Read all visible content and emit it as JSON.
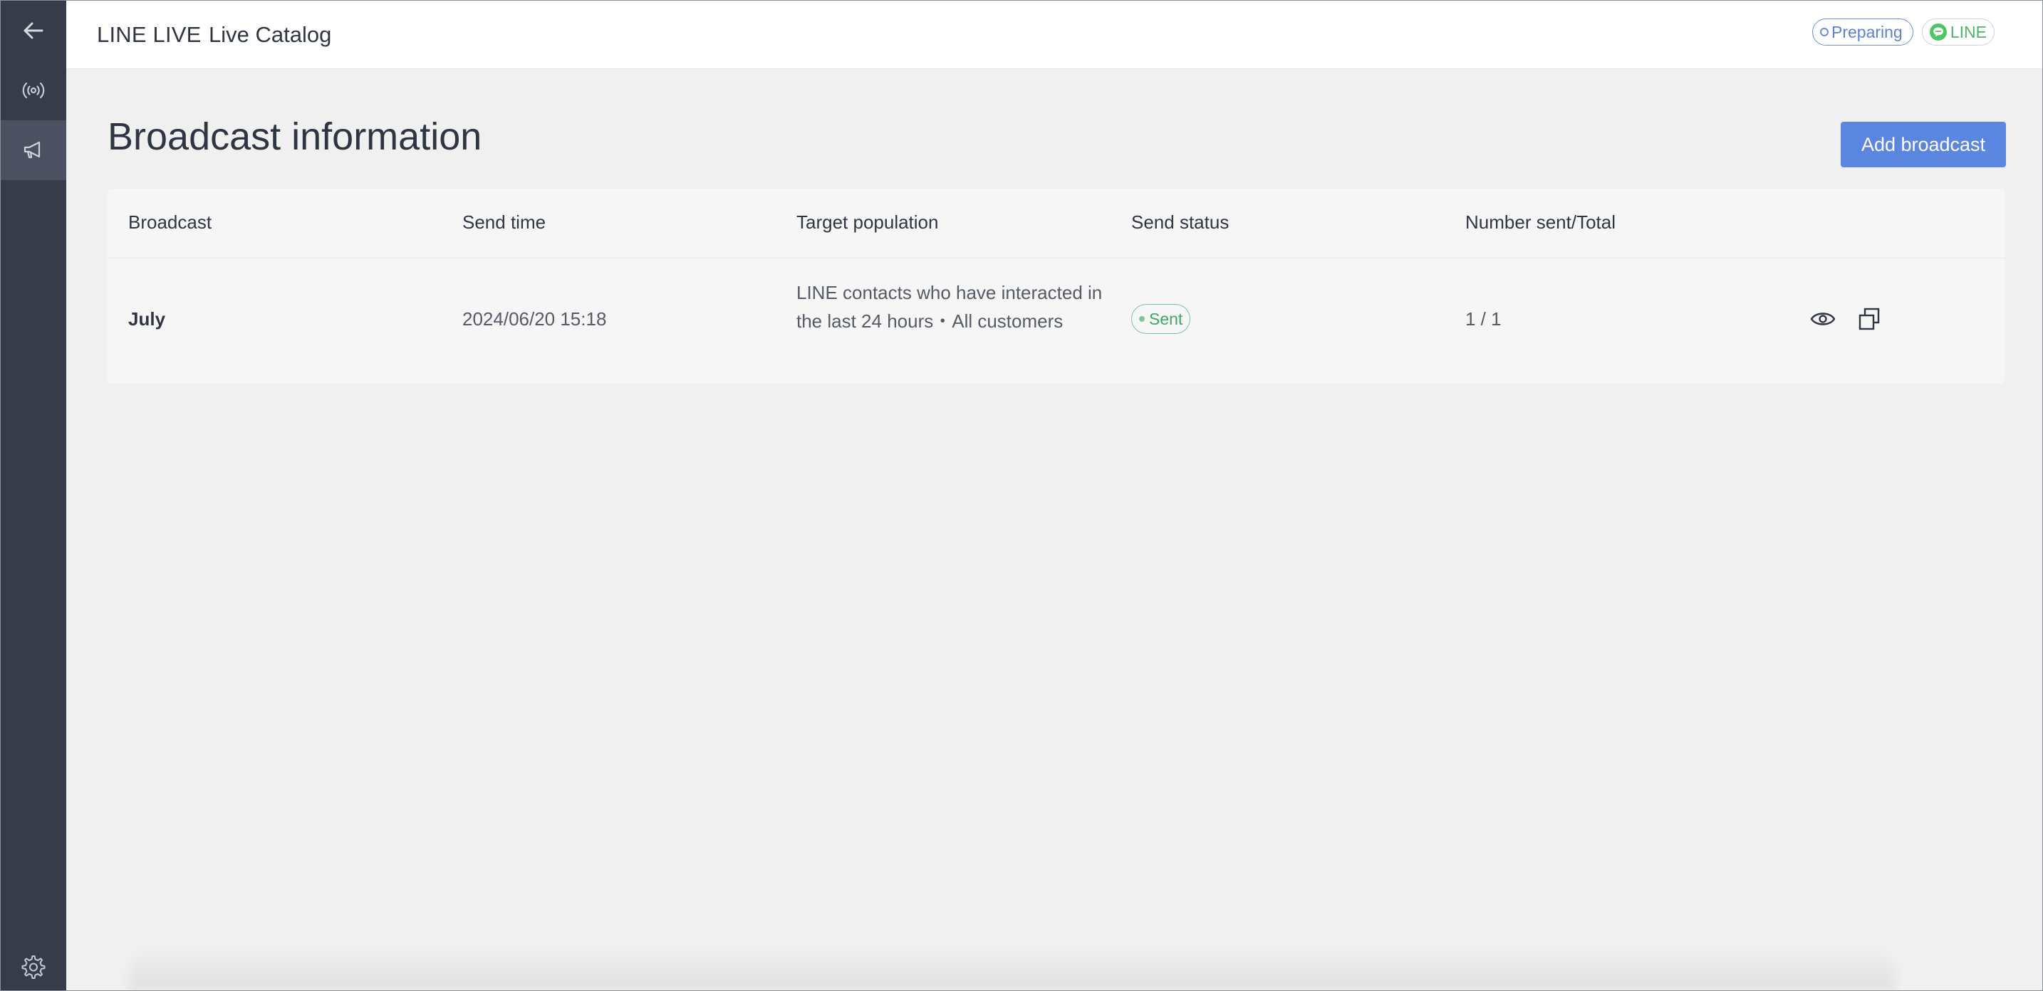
{
  "header": {
    "app_name": "LINE LIVE",
    "catalog_name": "Live Catalog",
    "badges": {
      "preparing": "Preparing",
      "line": "LINE"
    }
  },
  "sidebar": {
    "items": [
      {
        "icon": "back-arrow-icon"
      },
      {
        "icon": "broadcast-signal-icon"
      },
      {
        "icon": "megaphone-icon",
        "active": true
      },
      {
        "icon": "gear-icon"
      }
    ]
  },
  "main": {
    "title": "Broadcast information",
    "add_button": "Add broadcast",
    "table": {
      "columns": [
        "Broadcast",
        "Send time",
        "Target population",
        "Send status",
        "Number sent/Total"
      ],
      "rows": [
        {
          "broadcast": "July",
          "send_time": "2024/06/20 15:18",
          "target_population": "LINE contacts who have interacted in the last 24 hours・All customers",
          "send_status": "Sent",
          "number_sent_total": "1 / 1",
          "actions": [
            "eye-icon",
            "copy-icon"
          ]
        }
      ]
    }
  },
  "colors": {
    "sidebar": "#363c4a",
    "accent": "#5b86e0",
    "success": "#3fa56a",
    "line_green": "#4cc764"
  }
}
